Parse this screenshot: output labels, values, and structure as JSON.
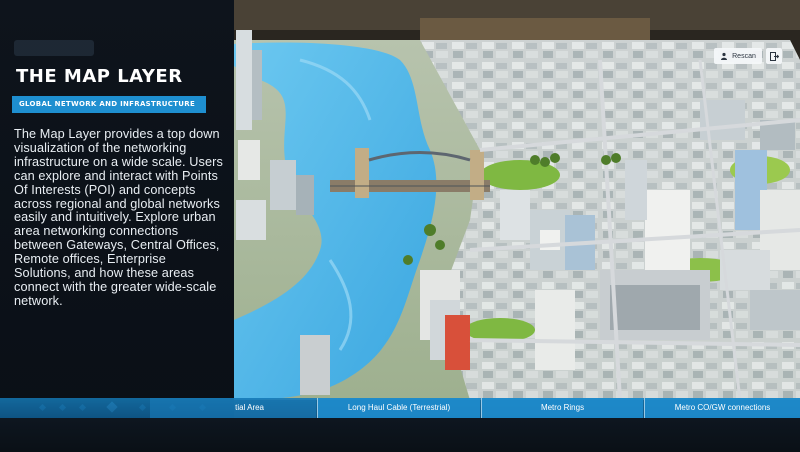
{
  "panel": {
    "title": "THE MAP LAYER",
    "subtitle": "GLOBAL NETWORK AND INFRASTRUCTURE",
    "body": "The Map Layer provides a top down visualization of the networking infrastructure on a wide scale. Users can explore and interact with Points Of Interests (POI) and concepts across regional and global networks easily and intuitively. Explore urban area networking connections between Gateways, Central Offices, Remote offices, Enterprise Solutions, and how these areas connect with the greater wide-scale network."
  },
  "controls": {
    "rescan_label": "Rescan",
    "rescan_icon": "person-scan-icon",
    "exit_icon": "exit-icon"
  },
  "tabs": [
    {
      "label": "tial Area"
    },
    {
      "label": "Long Haul Cable (Terrestrial)"
    },
    {
      "label": "Metro Rings"
    },
    {
      "label": "Metro CO/GW connections"
    }
  ],
  "colors": {
    "accent": "#1e8fd0",
    "river": "#4fb6e8",
    "grass": "#8cc04a",
    "road": "#c9cdd2"
  }
}
